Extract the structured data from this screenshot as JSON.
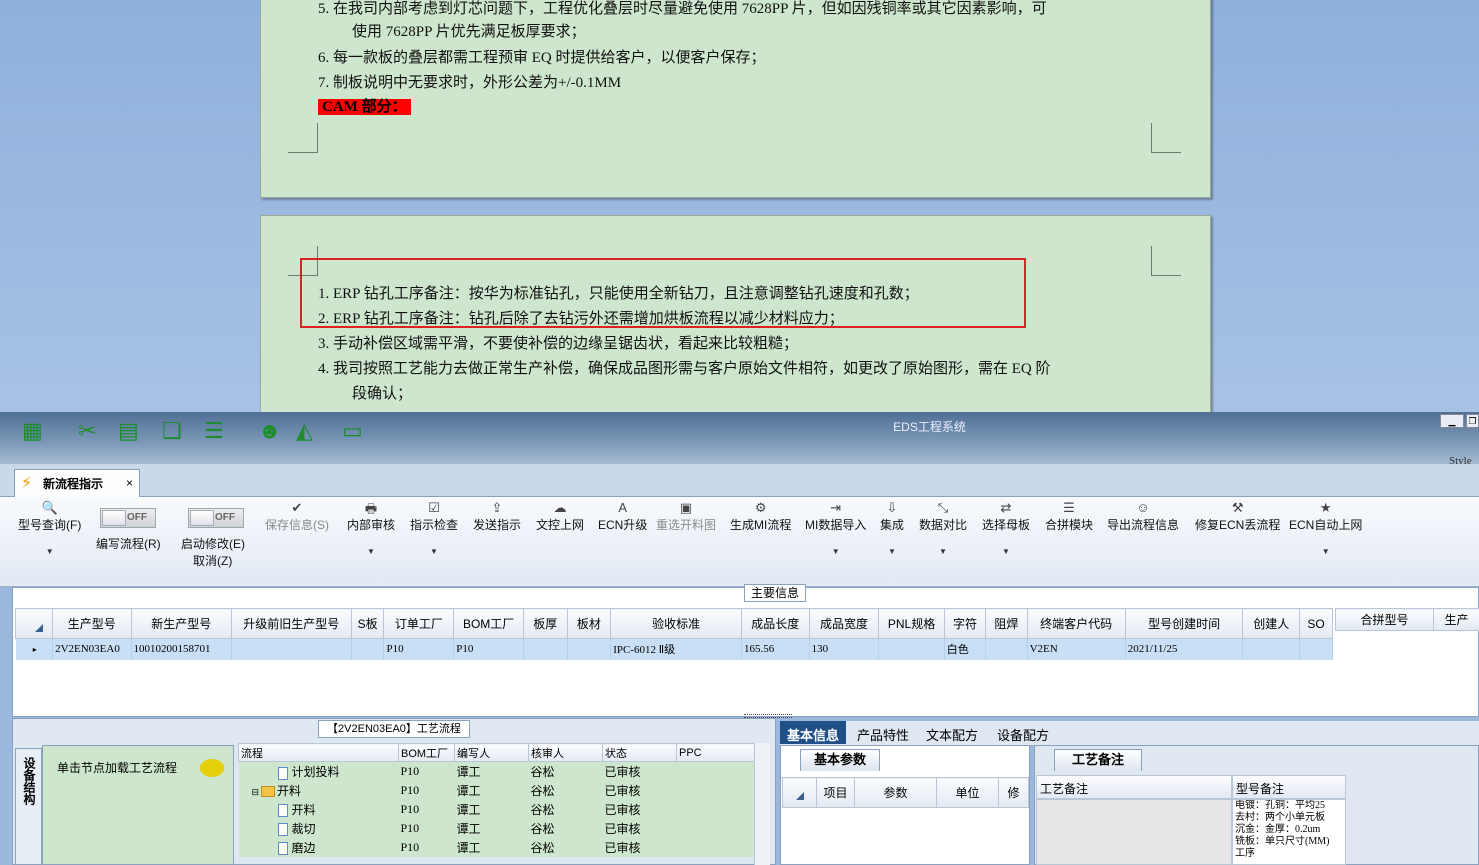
{
  "document": {
    "page1_lines": [
      "5.    在我司内部考虑到灯芯问题下，工程优化叠层时尽量避免使用 7628PP 片，但如因残铜率或其它因素影响，可",
      "使用 7628PP 片优先满足板厚要求；",
      "6.    每一款板的叠层都需工程预审 EQ 时提供给客户，以便客户保存；",
      "7.  制板说明中无要求时，外形公差为+/-0.1MM"
    ],
    "cam_heading": "CAM 部分：",
    "page2_lines": [
      "1.    ERP 钻孔工序备注：按华为标准钻孔，只能使用全新钻刀，且注意调整钻孔速度和孔数；",
      "2.    ERP 钻孔工序备注：钻孔后除了去钻污外还需增加烘板流程以减少材料应力；",
      "3.    手动补偿区域需平滑，不要使补偿的边缘呈锯齿状，看起来比较粗糙；",
      "4.    我司按照工艺能力去做正常生产补偿，确保成品图形需与客户原始文件相符，如更改了原始图形，需在 EQ 阶",
      "段确认；"
    ],
    "style_label": "Style"
  },
  "app": {
    "title": "EDS工程系统",
    "tab_label": "新流程指示",
    "tab_close": "×"
  },
  "ribbon": {
    "query": "型号查询(F)",
    "toggle_off": "OFF",
    "edit_flow": "编写流程(R)",
    "start_modify": "启动修改(E)",
    "cancel": "取消(Z)",
    "save_info": "保存信息(S)",
    "items": [
      {
        "label": "内部审核",
        "icon": "🖶",
        "arrow": true
      },
      {
        "label": "指示检查",
        "icon": "☑",
        "arrow": true
      },
      {
        "label": "发送指示",
        "icon": "⇪",
        "arrow": false
      },
      {
        "label": "文控上网",
        "icon": "☁",
        "arrow": false
      },
      {
        "label": "ECN升级",
        "icon": "A",
        "arrow": false
      },
      {
        "label": "重选开料图",
        "icon": "▣",
        "arrow": false
      },
      {
        "label": "生成MI流程",
        "icon": "⚙",
        "arrow": false
      },
      {
        "label": "MI数据导入",
        "icon": "⇥",
        "arrow": true
      },
      {
        "label": "集成",
        "icon": "⇩",
        "arrow": true
      },
      {
        "label": "数据对比",
        "icon": "⤡",
        "arrow": true
      },
      {
        "label": "选择母板",
        "icon": "⇄",
        "arrow": true
      },
      {
        "label": "合拼模块",
        "icon": "☰",
        "arrow": false
      },
      {
        "label": "导出流程信息",
        "icon": "☺",
        "arrow": false
      },
      {
        "label": "修复ECN丢流程",
        "icon": "⚒",
        "arrow": false
      },
      {
        "label": "ECN自动上网",
        "icon": "★",
        "arrow": true
      }
    ]
  },
  "main": {
    "section_title": "主要信息",
    "columns": [
      "生产型号",
      "新生产型号",
      "升级前旧生产型号",
      "S板",
      "订单工厂",
      "BOM工厂",
      "板厚",
      "板材",
      "验收标准",
      "成品长度",
      "成品宽度",
      "PNL规格",
      "字符",
      "阻焊",
      "终端客户代码",
      "型号创建时间",
      "创建人",
      "SO"
    ],
    "rows": [
      [
        "2V2EN03EA0",
        "10010200158701",
        "",
        "",
        "P10",
        "P10",
        "",
        "",
        "IPC-6012 Ⅱ级",
        "165.56",
        "130",
        "",
        "白色",
        "",
        "V2EN",
        "2021/11/25",
        "",
        ""
      ]
    ],
    "right_columns": [
      "合拼型号",
      "生产"
    ]
  },
  "process": {
    "section_title": "【2V2EN03EA0】工艺流程",
    "vertical_tab": "设备结构",
    "node_hint": "单击节点加载工艺流程",
    "columns": [
      "流程",
      "BOM工厂",
      "编写人",
      "核审人",
      "状态",
      "PPC"
    ],
    "rows": [
      {
        "name": "计划投料",
        "type": "doc",
        "indent": 3,
        "bom": "P10",
        "writer": "谭工",
        "reviewer": "谷松",
        "status": "已审核"
      },
      {
        "name": "开料",
        "type": "folder",
        "indent": 1,
        "bom": "P10",
        "writer": "谭工",
        "reviewer": "谷松",
        "status": "已审核"
      },
      {
        "name": "开料",
        "type": "doc",
        "indent": 3,
        "bom": "P10",
        "writer": "谭工",
        "reviewer": "谷松",
        "status": "已审核"
      },
      {
        "name": "裁切",
        "type": "doc",
        "indent": 3,
        "bom": "P10",
        "writer": "谭工",
        "reviewer": "谷松",
        "status": "已审核"
      },
      {
        "name": "磨边",
        "type": "doc",
        "indent": 3,
        "bom": "P10",
        "writer": "谭工",
        "reviewer": "谷松",
        "status": "已审核"
      }
    ]
  },
  "details": {
    "tabs": [
      "基本信息",
      "产品特性",
      "文本配方",
      "设备配方"
    ],
    "basic_params_title": "基本参数",
    "param_columns": [
      "项目",
      "参数",
      "单位",
      "修"
    ],
    "craft_title": "工艺备注",
    "craft_remark_col": "工艺备注",
    "model_remark_col": "型号备注",
    "model_remark_lines": [
      "电镀：孔铜：平均25",
      "去村：两个小单元板",
      "沉金：金厚：0.2um",
      "铣板：单只尺寸(MM)",
      "工序"
    ]
  }
}
